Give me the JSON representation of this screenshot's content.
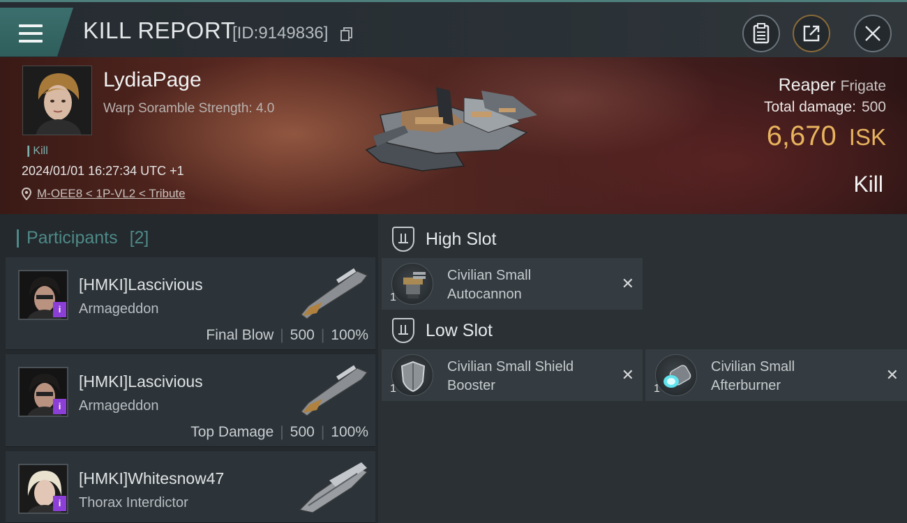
{
  "header": {
    "title": "KILL REPORT",
    "report_id": "[ID:9149836]",
    "icons": [
      "menu-icon",
      "copy-icon",
      "clipboard-icon",
      "share-icon",
      "close-icon"
    ]
  },
  "victim": {
    "name": "LydiaPage",
    "stat": "Warp Soramble Strength: 4.0",
    "kill_tag": "Kill",
    "timestamp": "2024/01/01 16:27:34 UTC +1",
    "location": "M-OEE8 < 1P-VL2 < Tribute",
    "ship_name": "Reaper",
    "ship_class": "Frigate",
    "damage_label": "Total damage:",
    "damage_value": "500",
    "isk_amount": "6,670",
    "isk_currency": "ISK",
    "result": "Kill"
  },
  "participants": {
    "label": "Participants",
    "count": "[2]",
    "items": [
      {
        "name": "[HMKI]Lascivious",
        "ship": "Armageddon",
        "role": "Final Blow",
        "damage": "500",
        "percent": "100%"
      },
      {
        "name": "[HMKI]Lascivious",
        "ship": "Armageddon",
        "role": "Top Damage",
        "damage": "500",
        "percent": "100%"
      },
      {
        "name": "[HMKI]Whitesnow47",
        "ship": "Thorax Interdictor"
      }
    ]
  },
  "fitting": {
    "high_slot": {
      "title": "High Slot",
      "modules": [
        {
          "line1": "Civilian Small",
          "line2": "Autocannon",
          "qty": "1"
        }
      ]
    },
    "low_slot": {
      "title": "Low Slot",
      "modules": [
        {
          "line1": "Civilian Small Shield",
          "line2": "Booster",
          "qty": "1"
        },
        {
          "line1": "Civilian Small",
          "line2": "Afterburner",
          "qty": "1"
        }
      ]
    },
    "remove_glyph": "✕"
  },
  "colors": {
    "accent_teal": "#4e8a88",
    "isk_gold": "#e8b45e",
    "badge_purple": "#8c3fd6"
  }
}
